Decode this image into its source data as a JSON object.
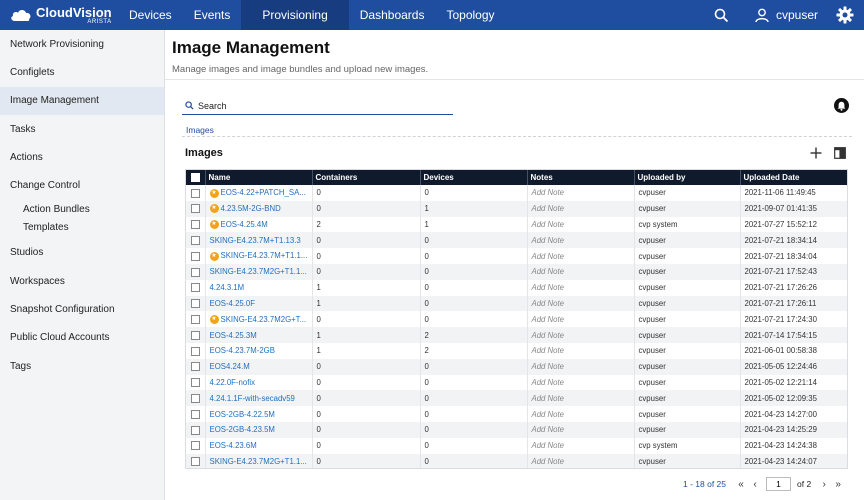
{
  "brand": {
    "title": "CloudVision",
    "subtitle": "ARISTA"
  },
  "nav": {
    "items": [
      "Devices",
      "Events",
      "Provisioning",
      "Dashboards",
      "Topology"
    ],
    "active": "Provisioning",
    "username": "cvpuser"
  },
  "icons": {
    "search": "search-icon",
    "user": "user-icon",
    "settings": "gear-icon",
    "add": "plus-icon",
    "columns": "columns-icon",
    "alert": "bell-icon"
  },
  "colors": {
    "navbar": "#1f4ea0",
    "navbar_active": "#173d80",
    "link": "#1f6fc0",
    "table_header": "#0f1b2d",
    "star": "#f0a31c"
  },
  "sidebar": {
    "items": [
      {
        "label": "Network Provisioning"
      },
      {
        "label": "Configlets"
      },
      {
        "label": "Image Management",
        "active": true
      },
      {
        "label": "Tasks"
      },
      {
        "label": "Actions"
      },
      {
        "label": "Change Control"
      }
    ],
    "change_control_sub": [
      "Action Bundles",
      "Templates"
    ],
    "items_after": [
      {
        "label": "Studios"
      },
      {
        "label": "Workspaces"
      },
      {
        "label": "Snapshot Configuration"
      },
      {
        "label": "Public Cloud Accounts"
      },
      {
        "label": "Tags"
      }
    ]
  },
  "page": {
    "title": "Image Management",
    "description": "Manage images and image bundles and upload new images.",
    "search_placeholder": "Search",
    "breadcrumb": "Images",
    "section_title": "Images"
  },
  "table": {
    "columns": [
      "Name",
      "Containers",
      "Devices",
      "Notes",
      "Uploaded by",
      "Uploaded Date"
    ],
    "rows": [
      {
        "star": true,
        "name": "EOS-4.22+PATCH_SA...",
        "containers": "0",
        "devices": "0",
        "notes": "Add Note",
        "uploaded_by": "cvpuser",
        "date": "2021-11-06 11:49:45"
      },
      {
        "star": true,
        "name": "4.23.5M-2G-BND",
        "containers": "0",
        "devices": "1",
        "notes": "Add Note",
        "uploaded_by": "cvpuser",
        "date": "2021-09-07 01:41:35"
      },
      {
        "star": true,
        "name": "EOS-4.25.4M",
        "containers": "2",
        "devices": "1",
        "notes": "Add Note",
        "uploaded_by": "cvp system",
        "date": "2021-07-27 15:52:12"
      },
      {
        "star": false,
        "name": "SKING-E4.23.7M+T1.13.3",
        "containers": "0",
        "devices": "0",
        "notes": "Add Note",
        "uploaded_by": "cvpuser",
        "date": "2021-07-21 18:34:14"
      },
      {
        "star": true,
        "name": "SKING-E4.23.7M+T1.1...",
        "containers": "0",
        "devices": "0",
        "notes": "Add Note",
        "uploaded_by": "cvpuser",
        "date": "2021-07-21 18:34:04"
      },
      {
        "star": false,
        "name": "SKING-E4.23.7M2G+T1.1...",
        "containers": "0",
        "devices": "0",
        "notes": "Add Note",
        "uploaded_by": "cvpuser",
        "date": "2021-07-21 17:52:43"
      },
      {
        "star": false,
        "name": "4.24.3.1M",
        "containers": "1",
        "devices": "0",
        "notes": "Add Note",
        "uploaded_by": "cvpuser",
        "date": "2021-07-21 17:26:26"
      },
      {
        "star": false,
        "name": "EOS-4.25.0F",
        "containers": "1",
        "devices": "0",
        "notes": "Add Note",
        "uploaded_by": "cvpuser",
        "date": "2021-07-21 17:26:11"
      },
      {
        "star": true,
        "name": "SKING-E4.23.7M2G+T...",
        "containers": "0",
        "devices": "0",
        "notes": "Add Note",
        "uploaded_by": "cvpuser",
        "date": "2021-07-21 17:24:30"
      },
      {
        "star": false,
        "name": "EOS-4.25.3M",
        "containers": "1",
        "devices": "2",
        "notes": "Add Note",
        "uploaded_by": "cvpuser",
        "date": "2021-07-14 17:54:15"
      },
      {
        "star": false,
        "name": "EOS-4.23.7M-2GB",
        "containers": "1",
        "devices": "2",
        "notes": "Add Note",
        "uploaded_by": "cvpuser",
        "date": "2021-06-01 00:58:38"
      },
      {
        "star": false,
        "name": "EOS4.24.M",
        "containers": "0",
        "devices": "0",
        "notes": "Add Note",
        "uploaded_by": "cvpuser",
        "date": "2021-05-05 12:24:46"
      },
      {
        "star": false,
        "name": "4.22.0F-nofix",
        "containers": "0",
        "devices": "0",
        "notes": "Add Note",
        "uploaded_by": "cvpuser",
        "date": "2021-05-02 12:21:14"
      },
      {
        "star": false,
        "name": "4.24.1.1F-with-secadv59",
        "containers": "0",
        "devices": "0",
        "notes": "Add Note",
        "uploaded_by": "cvpuser",
        "date": "2021-05-02 12:09:35"
      },
      {
        "star": false,
        "name": "EOS-2GB-4.22.5M",
        "containers": "0",
        "devices": "0",
        "notes": "Add Note",
        "uploaded_by": "cvpuser",
        "date": "2021-04-23 14:27:00"
      },
      {
        "star": false,
        "name": "EOS-2GB-4.23.5M",
        "containers": "0",
        "devices": "0",
        "notes": "Add Note",
        "uploaded_by": "cvpuser",
        "date": "2021-04-23 14:25:29"
      },
      {
        "star": false,
        "name": "EOS-4.23.6M",
        "containers": "0",
        "devices": "0",
        "notes": "Add Note",
        "uploaded_by": "cvp system",
        "date": "2021-04-23 14:24:38"
      },
      {
        "star": false,
        "name": "SKING-E4.23.7M2G+T1.1...",
        "containers": "0",
        "devices": "0",
        "notes": "Add Note",
        "uploaded_by": "cvpuser",
        "date": "2021-04-23 14:24:07"
      }
    ]
  },
  "pagination": {
    "range": "1 - 18 of 25",
    "current_page": "1",
    "of_pages": "of 2"
  }
}
